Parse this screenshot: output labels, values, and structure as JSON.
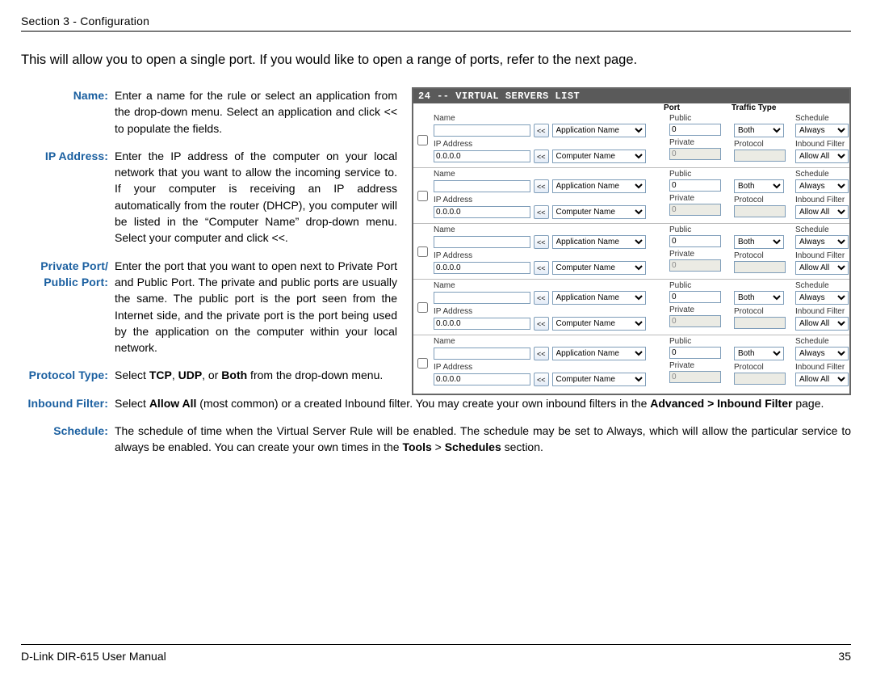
{
  "header": "Section 3 - Configuration",
  "intro": "This will allow you to open a single port. If you would like to open a range of ports, refer to the next page.",
  "footer_left": "D-Link DIR-615 User Manual",
  "footer_right": "35",
  "defs": [
    {
      "label": "Name:",
      "short": true,
      "text": "Enter a name for the rule or select an application from the drop-down menu. Select an application and click << to populate the fields."
    },
    {
      "label": "IP Address:",
      "short": true,
      "text": "Enter the IP address of the computer on your local network that you want to allow the incoming service to. If your computer is receiving an IP address automatically from the router (DHCP), you computer will be listed in the “Computer Name” drop-down menu. Select your computer and click <<."
    },
    {
      "label": "Private Port/ Public Port:",
      "short": true,
      "text": "Enter the port that you want to open next to Private Port and Public Port. The private and public ports are usually the same. The public port is the port seen from the Internet side, and the private port is the port being used by the application on the computer within your local network."
    },
    {
      "label": "Protocol Type:",
      "short": true,
      "html": "Select <b>TCP</b>, <b>UDP</b>, or <b>Both</b> from the drop-down menu."
    },
    {
      "label": "Inbound Filter:",
      "short": false,
      "html": "Select <b>Allow All</b> (most common) or a created Inbound filter. You may create your own inbound filters in the <b>Advanced > Inbound Filter</b> page."
    },
    {
      "label": "Schedule:",
      "short": false,
      "html": "The schedule of time when the Virtual Server Rule will be enabled. The schedule may be set to Always, which will allow the particular service to always be enabled. You can create your own times in the <b>Tools</b> > <b>Schedules</b> section."
    }
  ],
  "panel": {
    "title": "24 -- VIRTUAL SERVERS LIST",
    "columns": {
      "port": "Port",
      "traffic": "Traffic Type"
    },
    "labels": {
      "name": "Name",
      "ip": "IP Address",
      "public": "Public",
      "private": "Private",
      "schedule": "Schedule",
      "protocol": "Protocol",
      "inbound": "Inbound Filter",
      "app": "Application Name",
      "comp": "Computer Name",
      "btn": "<<"
    },
    "defaults": {
      "ip": "0.0.0.0",
      "public": "0",
      "private": "0",
      "traffic": "Both",
      "schedule": "Always",
      "filter": "Allow All"
    },
    "row_count": 5
  }
}
